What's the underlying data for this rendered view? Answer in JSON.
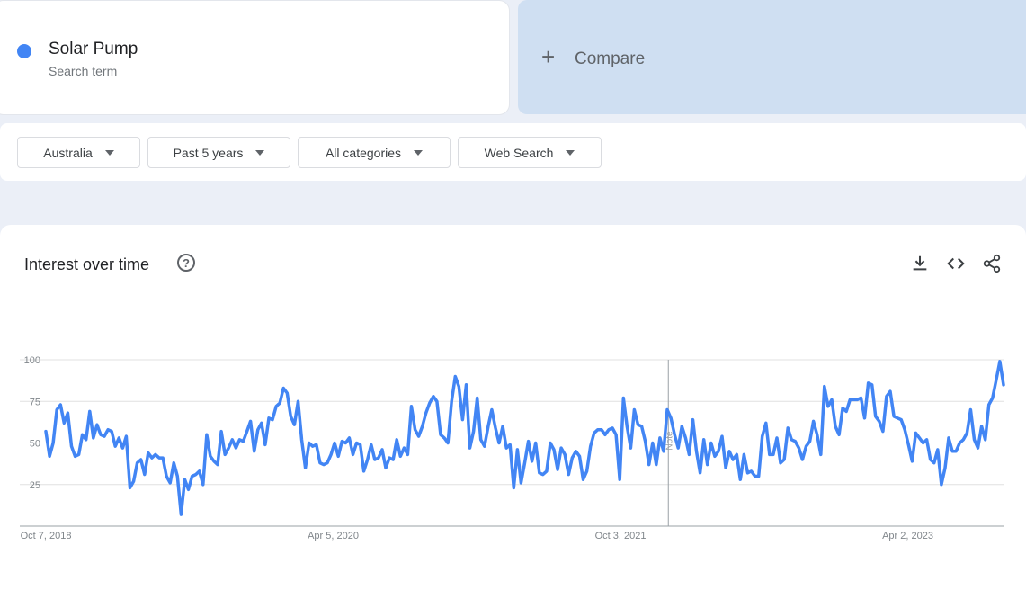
{
  "search_term": {
    "name": "Solar Pump",
    "subtitle": "Search term",
    "color": "#4285f4"
  },
  "compare": {
    "label": "Compare"
  },
  "filters": [
    {
      "label": "Australia"
    },
    {
      "label": "Past 5 years"
    },
    {
      "label": "All categories"
    },
    {
      "label": "Web Search"
    }
  ],
  "chart_card": {
    "title": "Interest over time",
    "help_icon": "question-circle-icon",
    "actions": [
      "download-icon",
      "embed-code-icon",
      "share-icon"
    ]
  },
  "chart_data": {
    "type": "line",
    "title": "Interest over time",
    "xlabel": "",
    "ylabel": "",
    "ylim": [
      0,
      100
    ],
    "yticks": [
      25,
      50,
      75,
      100
    ],
    "grid": true,
    "line_color": "#4285f4",
    "x_start": "2018-10-07",
    "x_end": "2023-10-01",
    "xticks": [
      {
        "date": "2018-10-07",
        "label": "Oct 7, 2018"
      },
      {
        "date": "2020-04-05",
        "label": "Apr 5, 2020"
      },
      {
        "date": "2021-10-03",
        "label": "Oct 3, 2021"
      },
      {
        "date": "2023-04-02",
        "label": "Apr 2, 2023"
      }
    ],
    "annotation": {
      "date": "2022-01-02",
      "label": "Note"
    },
    "series": [
      {
        "values": [
          57,
          42,
          50,
          70,
          73,
          62,
          68,
          48,
          42,
          43,
          55,
          52,
          69,
          53,
          61,
          55,
          54,
          58,
          57,
          48,
          53,
          47,
          54,
          23,
          27,
          38,
          40,
          31,
          44,
          41,
          43,
          41,
          41,
          30,
          26,
          38,
          30,
          7,
          28,
          22,
          30,
          31,
          33,
          25,
          55,
          42,
          39,
          37,
          57,
          43,
          47,
          52,
          47,
          52,
          51,
          57,
          63,
          45,
          58,
          62,
          49,
          65,
          64,
          72,
          74,
          83,
          80,
          66,
          61,
          75,
          52,
          35,
          50,
          48,
          49,
          38,
          37,
          38,
          43,
          50,
          42,
          51,
          50,
          53,
          43,
          50,
          49,
          33,
          40,
          49,
          40,
          41,
          46,
          35,
          41,
          40,
          52,
          42,
          47,
          43,
          72,
          58,
          54,
          60,
          68,
          74,
          78,
          75,
          55,
          53,
          50,
          75,
          90,
          84,
          64,
          85,
          47,
          57,
          77,
          52,
          48,
          60,
          70,
          59,
          50,
          60,
          47,
          49,
          23,
          46,
          26,
          38,
          51,
          39,
          50,
          32,
          31,
          33,
          50,
          46,
          34,
          47,
          43,
          31,
          41,
          45,
          42,
          28,
          33,
          48,
          56,
          58,
          58,
          55,
          58,
          59,
          55,
          28,
          77,
          60,
          47,
          70,
          61,
          60,
          51,
          37,
          50,
          37,
          53,
          45,
          70,
          65,
          55,
          47,
          60,
          53,
          43,
          64,
          45,
          32,
          52,
          37,
          50,
          42,
          45,
          54,
          35,
          45,
          40,
          43,
          28,
          43,
          32,
          33,
          30,
          30,
          54,
          62,
          43,
          43,
          53,
          38,
          40,
          59,
          52,
          51,
          47,
          40,
          48,
          51,
          63,
          55,
          43,
          84,
          72,
          76,
          60,
          55,
          71,
          69,
          76,
          76,
          76,
          77,
          65,
          86,
          85,
          66,
          63,
          57,
          78,
          81,
          66,
          65,
          64,
          58,
          49,
          39,
          56,
          53,
          50,
          52,
          40,
          38,
          46,
          25,
          35,
          53,
          45,
          45,
          50,
          52,
          56,
          70,
          52,
          47,
          60,
          52,
          73,
          77,
          88,
          99,
          85
        ]
      }
    ]
  }
}
